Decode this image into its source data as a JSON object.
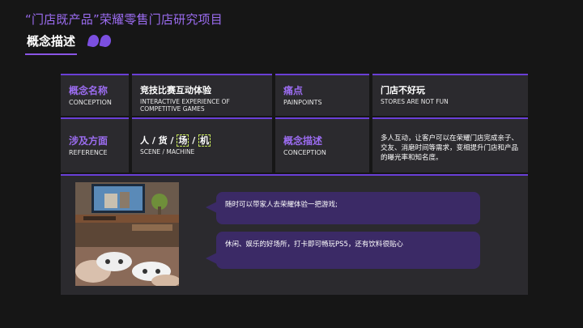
{
  "header": {
    "title": "“门店既产品”荣耀零售门店研究项目",
    "subtitle": "概念描述"
  },
  "grid": {
    "row1": [
      {
        "zh": "概念名称",
        "en": "CONCEPTION"
      },
      {
        "zh": "竞技比赛互动体验",
        "en": "INTERACTIVE EXPERIENCE OF COMPETITIVE GAMES"
      },
      {
        "zh": "痛点",
        "en": "PAINPOINTS"
      },
      {
        "zh": "门店不好玩",
        "en": "STORES ARE NOT FUN"
      }
    ],
    "row2": [
      {
        "zh": "涉及方面",
        "en": "REFERENCE"
      },
      {
        "zh_parts": [
          "人 / 货 / ",
          "场",
          " / ",
          "机"
        ],
        "en": "SCENE / MACHINE"
      },
      {
        "zh": "概念描述",
        "en": "CONCEPTION"
      },
      {
        "desc": "多人互动，让客户可以在荣耀门店完成亲子、交友、消磨时间等需求，变相提升门店和产品的曝光率和知名度。"
      }
    ]
  },
  "bubbles": [
    "随时可以带家人去荣耀体验一把游戏;",
    "休闲、娱乐的好场所，打卡即可畅玩PS5，还有饮料很贴心"
  ],
  "colors": {
    "accent": "#9b6cf0",
    "accent_line": "#6a3fd6",
    "panel": "#2b2a2e",
    "bubble": "#3b2a66",
    "background": "#161616",
    "highlight": "#c7e85a"
  },
  "icons": [
    "quote-mark-icon"
  ]
}
